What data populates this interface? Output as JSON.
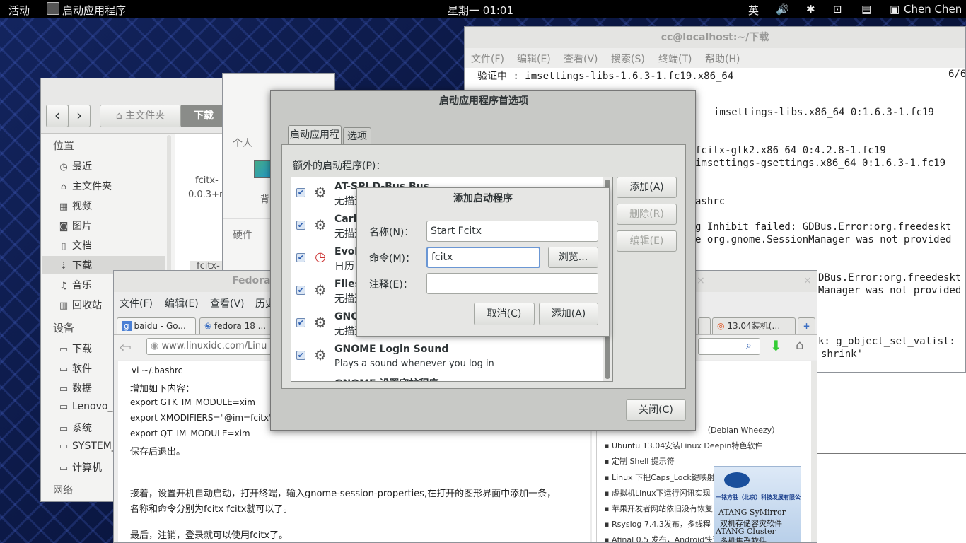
{
  "topbar": {
    "activities": "活动",
    "app_name": "启动应用程序",
    "clock": "星期一 01:01",
    "input_method": "英",
    "user": "Chen Chen"
  },
  "terminal": {
    "title": "cc@localhost:~/下载",
    "menu": [
      "文件(F)",
      "编辑(E)",
      "查看(V)",
      "搜索(S)",
      "终端(T)",
      "帮助(H)"
    ],
    "lines": [
      "验证中      :  imsettings-libs-1.6.3-1.fc19.x86_64",
      "imsettings-libs.x86_64 0:1.6.3-1.fc19",
      "fcitx-gtk2.x86_64 0:4.2.8-1.fc19",
      "imsettings-gsettings.x86_64 0:1.6.3-1.fc19",
      "ashrc",
      "g Inhibit failed:  GDBus.Error:org.freedeskt",
      "e org.gnome.SessionManager was not provided",
      "DBus.Error:org.freedeskt",
      "Manager was not provided",
      "k:  g_object_set_valist:",
      "shrink'"
    ],
    "progress": "6/6"
  },
  "files": {
    "back": "‹",
    "forward": "›",
    "home_crumb": "主文件夹",
    "current_crumb": "下载",
    "places_title": "位置",
    "places": [
      "最近",
      "主文件夹",
      "视频",
      "图片",
      "文档",
      "下载",
      "音乐",
      "回收站"
    ],
    "devices_title": "设备",
    "devices": [
      "下载",
      "软件",
      "数据",
      "Lenovo_",
      "系统",
      "SYSTEM_",
      "计算机"
    ],
    "network_title": "网络",
    "file_name1": "fcitx-",
    "file_name2": "0.0.3+r",
    "file_name3": "fcitx-"
  },
  "settings": {
    "personal": "个人",
    "hardware": "硬件",
    "bg_label": "背"
  },
  "prefs": {
    "title": "启动应用程序首选项",
    "tab_startup": "启动应用程序",
    "tab_options": "选项",
    "list_label": "额外的启动程序(P)：",
    "items": [
      {
        "name": "AT-SPI D-Bus Bus",
        "desc": "无描述"
      },
      {
        "name": "Carib",
        "desc": "无描述"
      },
      {
        "name": "Evol",
        "desc": "日历"
      },
      {
        "name": "Files",
        "desc": "无描述"
      },
      {
        "name": "GNO",
        "desc": "无描述"
      },
      {
        "name": "GNOME Login Sound",
        "desc": "Plays a sound whenever you log in"
      },
      {
        "name": "GNOME 设置守护程序",
        "desc": ""
      }
    ],
    "add": "添加(A)",
    "remove": "删除(R)",
    "edit": "编辑(E)",
    "close": "关闭(C)"
  },
  "add_dialog": {
    "title": "添加启动程序",
    "name_label": "名称(N)：",
    "name_value": "Start Fcitx",
    "command_label": "命令(M)：",
    "command_value": "fcitx",
    "browse": "浏览...",
    "comment_label": "注释(E)：",
    "comment_value": "",
    "cancel": "取消(C)",
    "add": "添加(A)"
  },
  "firefox": {
    "title": "Fedora 1",
    "menu": [
      "文件(F)",
      "编辑(E)",
      "查看(V)",
      "历史"
    ],
    "tabs": [
      "baidu - Go...",
      "fedora 18 ...",
      "13.04装机(…"
    ],
    "url": "www.linuxidc.com/Linu",
    "article": [
      "vi ~/.bashrc",
      "增加如下内容：",
      "export GTK_IM_MODULE=xim",
      "export XMODIFIERS=\"@im=fcitx\"",
      "export QT_IM_MODULE=xim",
      "保存后退出。",
      "接着，设置开机自动启动，打开终端，输入gnome-session-properties,在打开的图形界面中添加一条，",
      "名称和命令分别为fcitx fcitx就可以了。",
      "最后，注销，登录就可以使用fcitx了。"
    ],
    "sidebar_links": [
      "（Debian Wheezy）",
      "Ubuntu 13.04安装Linux Deepin特色软件",
      "定制 Shell 提示符",
      "Linux 下把Caps_Lock键映射成",
      "虚拟机Linux下运行闪讯实现",
      "苹果开发者网站依旧没有恢复",
      "Rsyslog 7.4.3发布，多线程",
      "Afinal 0.5 发布，Android快速"
    ],
    "ad": {
      "company": "一铭方胜（北京）科技发展有限公司",
      "line1": "ATANG SyMirror",
      "line2": "双机存储容灾软件",
      "line3": "ATANG Cluster",
      "line4": "多机集群软件"
    }
  }
}
